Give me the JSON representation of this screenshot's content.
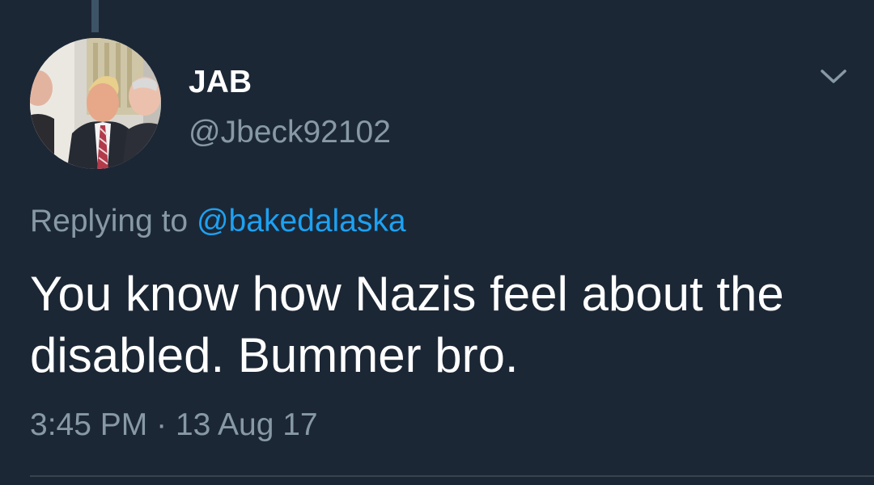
{
  "tweet": {
    "author": {
      "display_name": "JAB",
      "handle": "@Jbeck92102",
      "avatar_icon": "profile-photo"
    },
    "reply": {
      "prefix": "Replying to",
      "to_user": "@bakedalaska"
    },
    "text": "You know how Nazis feel about the disabled. Bummer bro.",
    "time": "3:45 PM",
    "separator": "·",
    "date": "13 Aug 17",
    "menu_icon": "chevron-down-icon"
  },
  "colors": {
    "background": "#1c2735",
    "primary_text": "#ffffff",
    "secondary_text": "#8899a6",
    "link": "#1da1f2",
    "thread_line": "#3d5466"
  }
}
